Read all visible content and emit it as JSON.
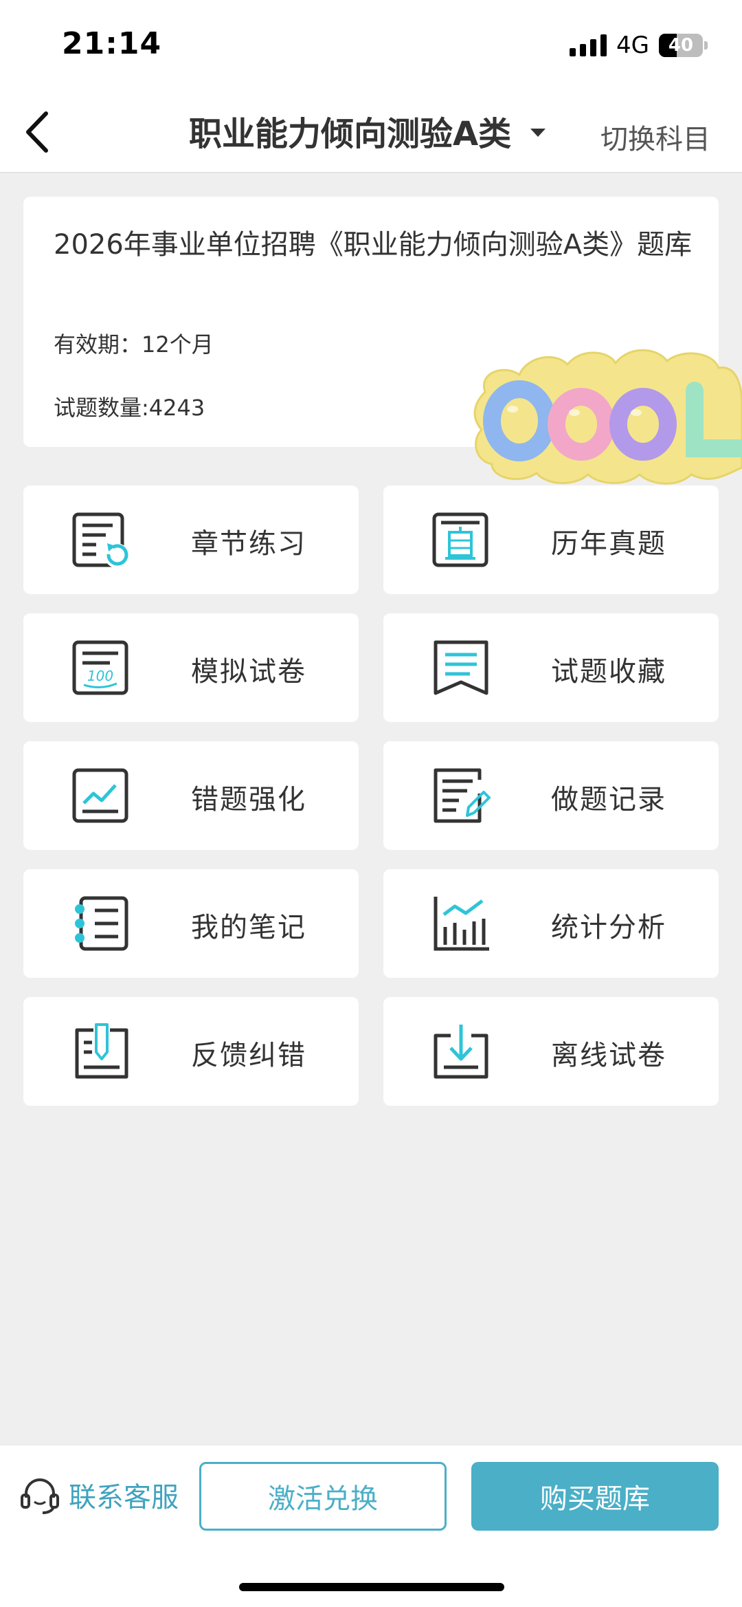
{
  "status_bar": {
    "time": "21:14",
    "network": "4G",
    "battery": "40",
    "battery_level": 0.4
  },
  "nav": {
    "title": "职业能力倾向测验A类",
    "switch_label": "切换科目"
  },
  "info": {
    "title": "2026年事业单位招聘《职业能力倾向测验A类》题库",
    "validity": "有效期：12个月",
    "question_count": "试题数量:4243",
    "sticker_text": "COOL"
  },
  "menu": [
    {
      "label": "章节练习",
      "icon": "chapter-practice-icon"
    },
    {
      "label": "历年真题",
      "icon": "past-exams-icon"
    },
    {
      "label": "模拟试卷",
      "icon": "mock-paper-icon"
    },
    {
      "label": "试题收藏",
      "icon": "favorites-icon"
    },
    {
      "label": "错题强化",
      "icon": "wrong-questions-icon"
    },
    {
      "label": "做题记录",
      "icon": "practice-record-icon"
    },
    {
      "label": "我的笔记",
      "icon": "notes-icon"
    },
    {
      "label": "统计分析",
      "icon": "statistics-icon"
    },
    {
      "label": "反馈纠错",
      "icon": "feedback-icon"
    },
    {
      "label": "离线试卷",
      "icon": "offline-download-icon"
    }
  ],
  "bottom": {
    "service_label": "联系客服",
    "activate_label": "激活兑换",
    "buy_label": "购买题库"
  },
  "colors": {
    "accent": "#4aafc7",
    "icon_accent": "#2ec4d8",
    "background": "#efefef"
  }
}
